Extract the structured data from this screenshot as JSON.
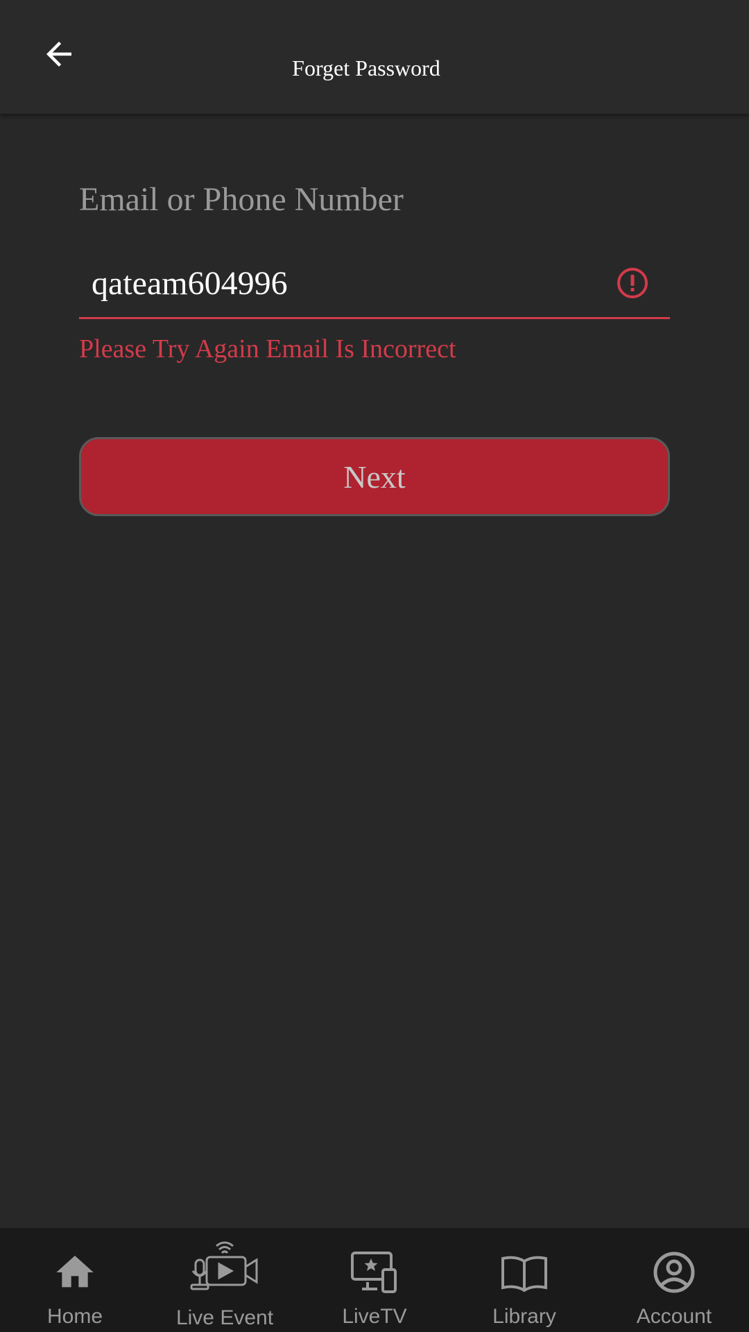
{
  "header": {
    "title": "Forget Password",
    "back_icon": "arrow-left-icon"
  },
  "form": {
    "label": "Email or Phone Number",
    "input_value": "qateam604996",
    "input_placeholder": "",
    "error_icon": "exclamation-circle-icon",
    "error_message": "Please Try Again Email Is Incorrect",
    "next_label": "Next"
  },
  "bottom_nav": {
    "items": [
      {
        "label": "Home",
        "icon": "home-icon"
      },
      {
        "label": "Live Event",
        "icon": "live-event-icon"
      },
      {
        "label": "LiveTV",
        "icon": "devices-star-icon"
      },
      {
        "label": "Library",
        "icon": "book-icon"
      },
      {
        "label": "Account",
        "icon": "account-circle-icon"
      }
    ]
  },
  "colors": {
    "background": "#282828",
    "app_bar": "#2a2a2a",
    "error": "#d33b4a",
    "primary_button": "#af222f",
    "nav_background": "#1a1a1a",
    "muted_text": "#9a9a9a"
  }
}
